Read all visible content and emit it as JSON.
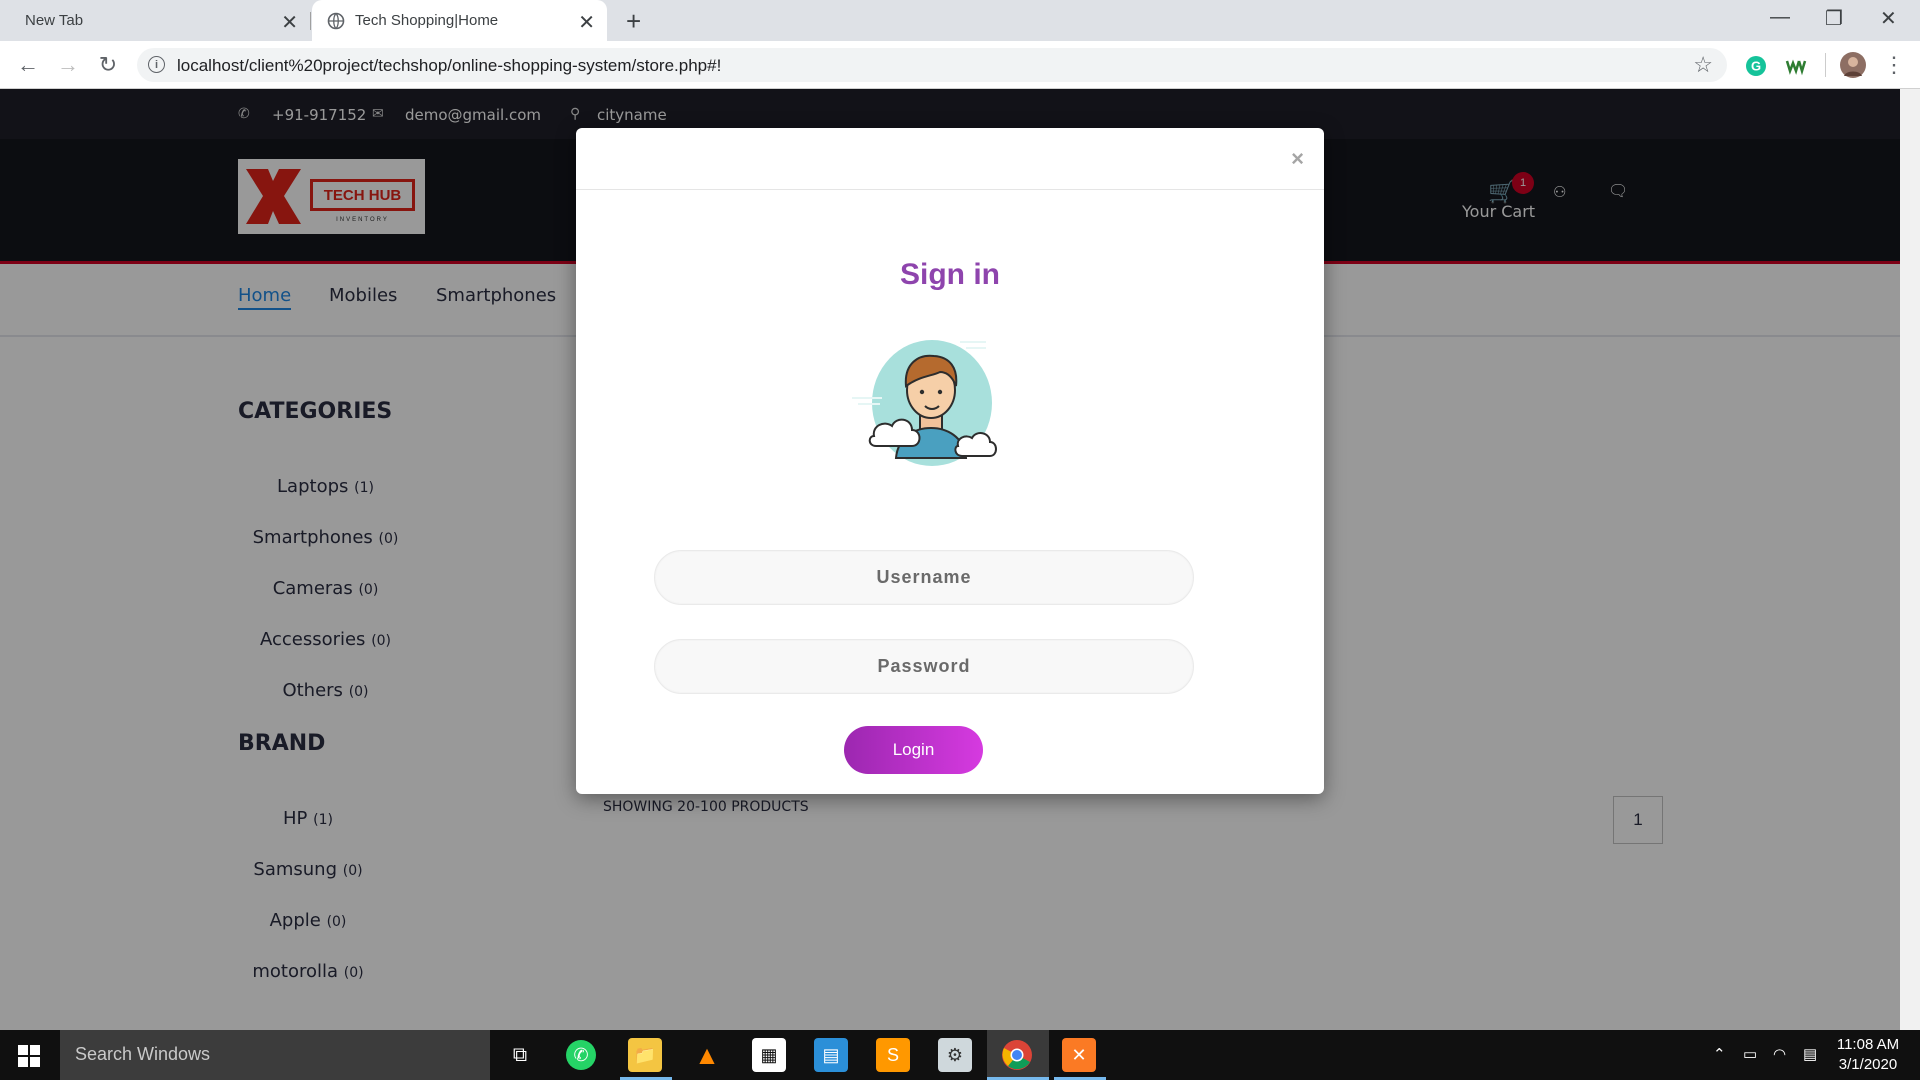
{
  "browser": {
    "tabs": [
      {
        "title": "New Tab"
      },
      {
        "title": "Tech Shopping|Home"
      }
    ],
    "url": "localhost/client%20project/techshop/online-shopping-system/store.php#!"
  },
  "site": {
    "topbar": {
      "phone": "+91-917152",
      "email": "demo@gmail.com",
      "location": "cityname"
    },
    "logo": {
      "text": "TECH HUB",
      "tagline": "INVENTORY"
    },
    "cart": {
      "label": "Your Cart",
      "count": "1"
    },
    "nav": [
      "Home",
      "Mobiles",
      "Smartphones"
    ],
    "categories_title": "CATEGORIES",
    "categories": [
      {
        "name": "Laptops",
        "count": "(1)"
      },
      {
        "name": "Smartphones",
        "count": "(0)"
      },
      {
        "name": "Cameras",
        "count": "(0)"
      },
      {
        "name": "Accessories",
        "count": "(0)"
      },
      {
        "name": "Others",
        "count": "(0)"
      }
    ],
    "brand_title": "BRAND",
    "brands": [
      {
        "name": "HP",
        "count": "(1)"
      },
      {
        "name": "Samsung",
        "count": "(0)"
      },
      {
        "name": "Apple",
        "count": "(0)"
      },
      {
        "name": "motorolla",
        "count": "(0)"
      }
    ],
    "showing": "SHOWING 20-100 PRODUCTS",
    "page": "1"
  },
  "modal": {
    "close": "×",
    "title": "Sign in",
    "username_placeholder": "Username",
    "password_placeholder": "Password",
    "login_label": "Login"
  },
  "taskbar": {
    "search_placeholder": "Search Windows",
    "time": "11:08 AM",
    "date": "3/1/2020"
  },
  "colors": {
    "accent_red": "#d10024",
    "modal_title": "#8e44ad",
    "login_gradient_start": "#9c27b0",
    "login_gradient_end": "#d63ae0",
    "nav_active": "#1e88e5"
  }
}
